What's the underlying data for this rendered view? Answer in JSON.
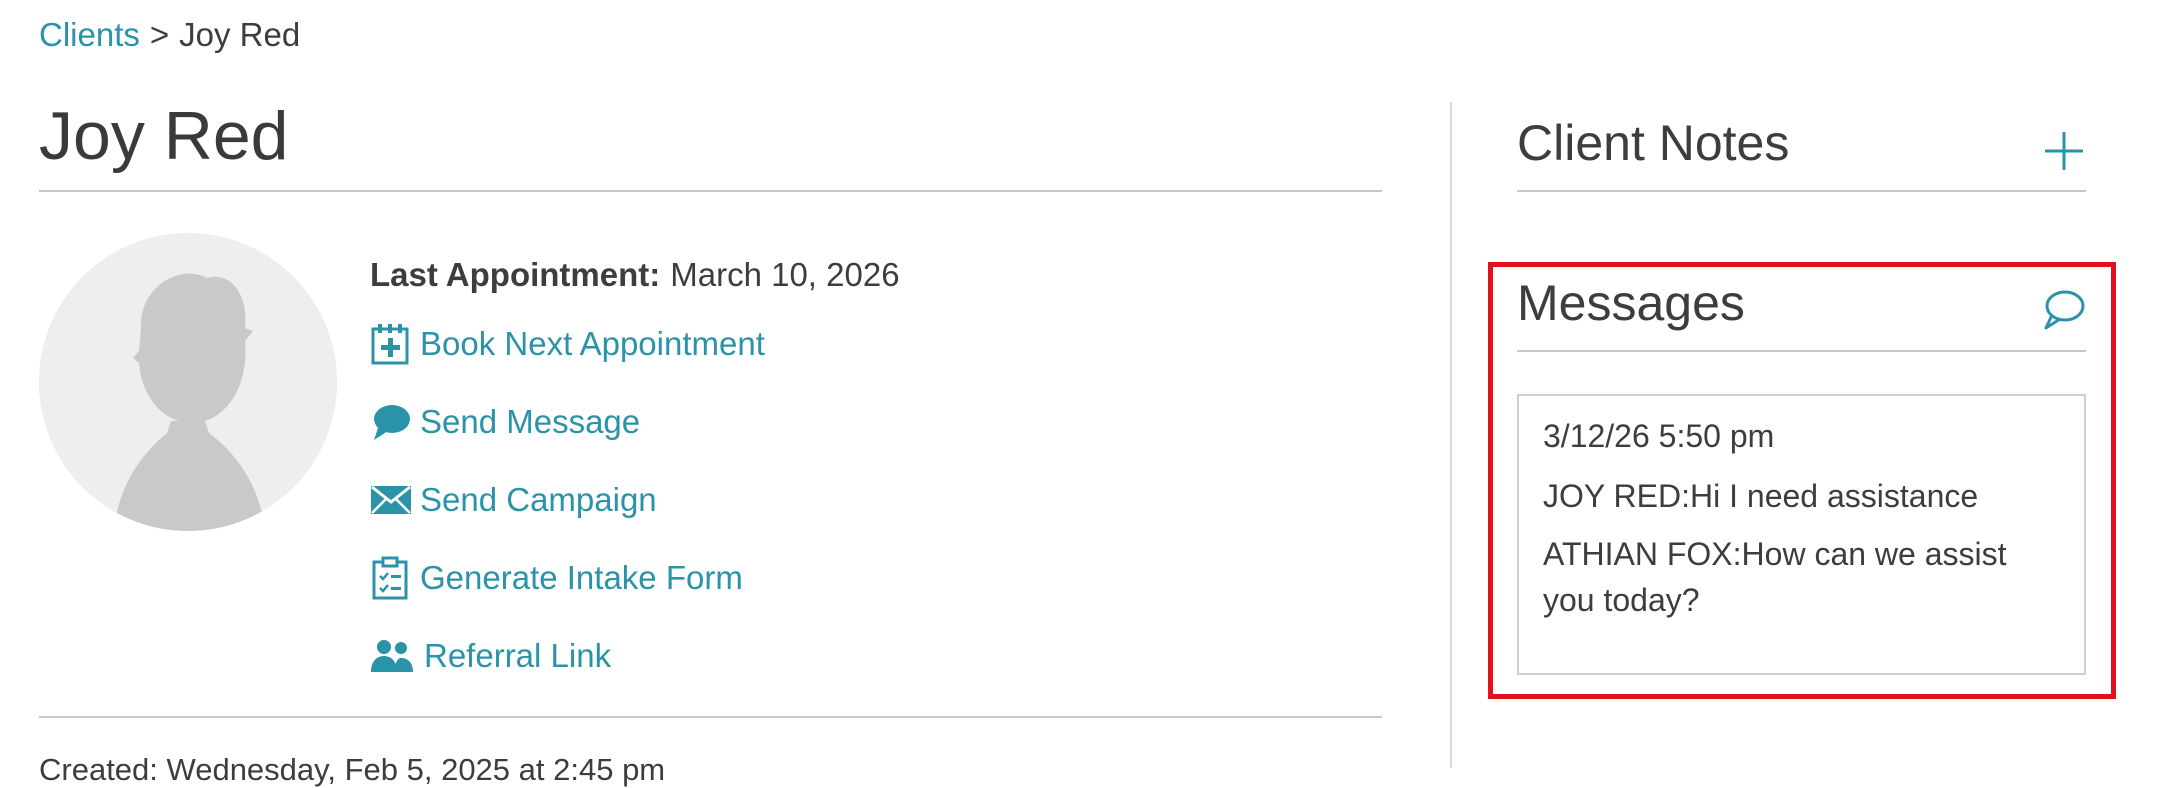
{
  "breadcrumb": {
    "parent": "Clients",
    "separator": ">",
    "current": "Joy Red"
  },
  "client": {
    "name": "Joy Red",
    "last_appointment_label": "Last Appointment:",
    "last_appointment_value": "March 10, 2026",
    "created": "Created: Wednesday, Feb 5, 2025 at 2:45 pm"
  },
  "actions": [
    {
      "label": "Book Next Appointment",
      "icon": "calendar-plus-icon"
    },
    {
      "label": "Send Message",
      "icon": "chat-bubble-icon"
    },
    {
      "label": "Send Campaign",
      "icon": "envelope-icon"
    },
    {
      "label": "Generate Intake Form",
      "icon": "clipboard-check-icon"
    },
    {
      "label": "Referral Link",
      "icon": "users-icon"
    }
  ],
  "notes": {
    "title": "Client Notes",
    "add_icon": "plus-icon"
  },
  "messages": {
    "title": "Messages",
    "icon": "chat-outline-icon",
    "date": "3/12/26 5:50 pm",
    "items": [
      {
        "text": "JOY RED:Hi I need assistance"
      },
      {
        "text": "ATHIAN FOX:How can we assist you today?"
      }
    ]
  },
  "colors": {
    "accent": "#2b93a8",
    "highlight": "#e3121a",
    "text": "#3d3d3d"
  }
}
